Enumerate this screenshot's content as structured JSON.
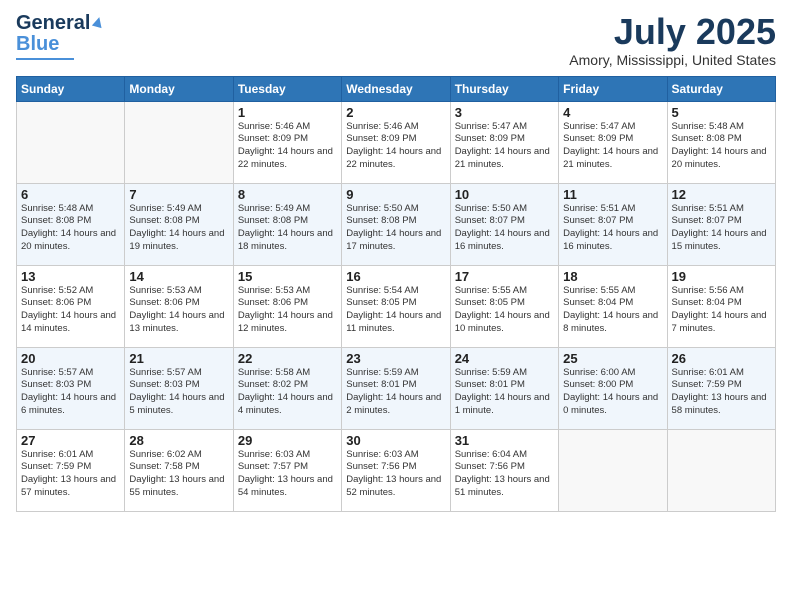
{
  "header": {
    "logo_general": "General",
    "logo_blue": "Blue",
    "month_title": "July 2025",
    "location": "Amory, Mississippi, United States"
  },
  "weekdays": [
    "Sunday",
    "Monday",
    "Tuesday",
    "Wednesday",
    "Thursday",
    "Friday",
    "Saturday"
  ],
  "weeks": [
    [
      {
        "day": "",
        "empty": true
      },
      {
        "day": "",
        "empty": true
      },
      {
        "day": "1",
        "sunrise": "5:46 AM",
        "sunset": "8:09 PM",
        "daylight": "14 hours and 22 minutes."
      },
      {
        "day": "2",
        "sunrise": "5:46 AM",
        "sunset": "8:09 PM",
        "daylight": "14 hours and 22 minutes."
      },
      {
        "day": "3",
        "sunrise": "5:47 AM",
        "sunset": "8:09 PM",
        "daylight": "14 hours and 21 minutes."
      },
      {
        "day": "4",
        "sunrise": "5:47 AM",
        "sunset": "8:09 PM",
        "daylight": "14 hours and 21 minutes."
      },
      {
        "day": "5",
        "sunrise": "5:48 AM",
        "sunset": "8:08 PM",
        "daylight": "14 hours and 20 minutes."
      }
    ],
    [
      {
        "day": "6",
        "sunrise": "5:48 AM",
        "sunset": "8:08 PM",
        "daylight": "14 hours and 20 minutes."
      },
      {
        "day": "7",
        "sunrise": "5:49 AM",
        "sunset": "8:08 PM",
        "daylight": "14 hours and 19 minutes."
      },
      {
        "day": "8",
        "sunrise": "5:49 AM",
        "sunset": "8:08 PM",
        "daylight": "14 hours and 18 minutes."
      },
      {
        "day": "9",
        "sunrise": "5:50 AM",
        "sunset": "8:08 PM",
        "daylight": "14 hours and 17 minutes."
      },
      {
        "day": "10",
        "sunrise": "5:50 AM",
        "sunset": "8:07 PM",
        "daylight": "14 hours and 16 minutes."
      },
      {
        "day": "11",
        "sunrise": "5:51 AM",
        "sunset": "8:07 PM",
        "daylight": "14 hours and 16 minutes."
      },
      {
        "day": "12",
        "sunrise": "5:51 AM",
        "sunset": "8:07 PM",
        "daylight": "14 hours and 15 minutes."
      }
    ],
    [
      {
        "day": "13",
        "sunrise": "5:52 AM",
        "sunset": "8:06 PM",
        "daylight": "14 hours and 14 minutes."
      },
      {
        "day": "14",
        "sunrise": "5:53 AM",
        "sunset": "8:06 PM",
        "daylight": "14 hours and 13 minutes."
      },
      {
        "day": "15",
        "sunrise": "5:53 AM",
        "sunset": "8:06 PM",
        "daylight": "14 hours and 12 minutes."
      },
      {
        "day": "16",
        "sunrise": "5:54 AM",
        "sunset": "8:05 PM",
        "daylight": "14 hours and 11 minutes."
      },
      {
        "day": "17",
        "sunrise": "5:55 AM",
        "sunset": "8:05 PM",
        "daylight": "14 hours and 10 minutes."
      },
      {
        "day": "18",
        "sunrise": "5:55 AM",
        "sunset": "8:04 PM",
        "daylight": "14 hours and 8 minutes."
      },
      {
        "day": "19",
        "sunrise": "5:56 AM",
        "sunset": "8:04 PM",
        "daylight": "14 hours and 7 minutes."
      }
    ],
    [
      {
        "day": "20",
        "sunrise": "5:57 AM",
        "sunset": "8:03 PM",
        "daylight": "14 hours and 6 minutes."
      },
      {
        "day": "21",
        "sunrise": "5:57 AM",
        "sunset": "8:03 PM",
        "daylight": "14 hours and 5 minutes."
      },
      {
        "day": "22",
        "sunrise": "5:58 AM",
        "sunset": "8:02 PM",
        "daylight": "14 hours and 4 minutes."
      },
      {
        "day": "23",
        "sunrise": "5:59 AM",
        "sunset": "8:01 PM",
        "daylight": "14 hours and 2 minutes."
      },
      {
        "day": "24",
        "sunrise": "5:59 AM",
        "sunset": "8:01 PM",
        "daylight": "14 hours and 1 minute."
      },
      {
        "day": "25",
        "sunrise": "6:00 AM",
        "sunset": "8:00 PM",
        "daylight": "14 hours and 0 minutes."
      },
      {
        "day": "26",
        "sunrise": "6:01 AM",
        "sunset": "7:59 PM",
        "daylight": "13 hours and 58 minutes."
      }
    ],
    [
      {
        "day": "27",
        "sunrise": "6:01 AM",
        "sunset": "7:59 PM",
        "daylight": "13 hours and 57 minutes."
      },
      {
        "day": "28",
        "sunrise": "6:02 AM",
        "sunset": "7:58 PM",
        "daylight": "13 hours and 55 minutes."
      },
      {
        "day": "29",
        "sunrise": "6:03 AM",
        "sunset": "7:57 PM",
        "daylight": "13 hours and 54 minutes."
      },
      {
        "day": "30",
        "sunrise": "6:03 AM",
        "sunset": "7:56 PM",
        "daylight": "13 hours and 52 minutes."
      },
      {
        "day": "31",
        "sunrise": "6:04 AM",
        "sunset": "7:56 PM",
        "daylight": "13 hours and 51 minutes."
      },
      {
        "day": "",
        "empty": true
      },
      {
        "day": "",
        "empty": true
      }
    ]
  ]
}
